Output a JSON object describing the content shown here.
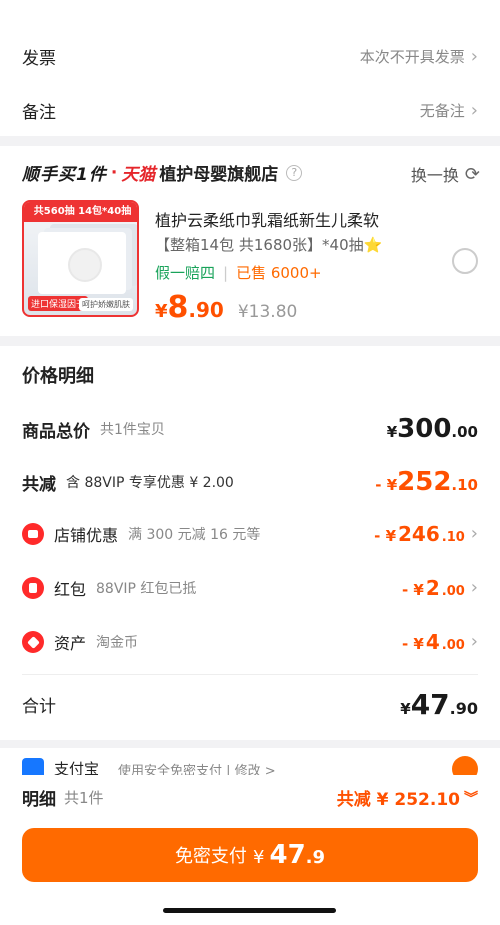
{
  "invoice": {
    "label": "发票",
    "value": "本次不开具发票"
  },
  "remark": {
    "label": "备注",
    "value": "无备注"
  },
  "shop": {
    "brand_sf": "顺手买1件",
    "brand_dot": "·",
    "brand_tm": "天猫",
    "name": "植护母婴旗舰店",
    "help_icon": "question-icon",
    "swap_label": "换一换",
    "swap_icon": "refresh-icon"
  },
  "product": {
    "thumb_top": "共560抽 14包*40抽",
    "thumb_bottom_left": "进口保湿因子",
    "thumb_bottom_right": "呵护娇嫩肌肤",
    "title": "植护云柔纸巾乳霜纸新生儿柔软",
    "spec": "【整箱14包 共1680张】*40抽",
    "spec_star": "⭐",
    "tag_fake": "假一赔四",
    "tag_sep": "|",
    "tag_sold": "已售 6000+",
    "price_currency": "¥",
    "price_int": "8",
    "price_dec": ".90",
    "price_original": "¥13.80"
  },
  "detail": {
    "title": "价格明细",
    "goods_total": {
      "label": "商品总价",
      "sub": "共1件宝贝",
      "currency": "¥",
      "int": "300",
      "dec": ".00"
    },
    "reduce": {
      "label": "共减",
      "sub": "含 88VIP 专享优惠 ¥ 2.00",
      "currency": "- ¥",
      "int": "252",
      "dec": ".10"
    },
    "shop_discount": {
      "label": "店铺优惠",
      "sub": "满 300 元减 16 元等",
      "currency": "- ¥",
      "int": "246",
      "dec": ".10"
    },
    "red_packet": {
      "label": "红包",
      "sub": "88VIP 红包已抵",
      "currency": "- ¥",
      "int": "2",
      "dec": ".00"
    },
    "assets": {
      "label": "资产",
      "sub": "淘金币",
      "currency": "- ¥",
      "int": "4",
      "dec": ".00"
    },
    "total": {
      "label": "合计",
      "currency": "¥",
      "int": "47",
      "dec": ".90"
    }
  },
  "payment_peek": {
    "method": "支付宝",
    "sub": "使用安全免密支付 | 修改 >"
  },
  "bottom": {
    "detail_label": "明细",
    "count": "共1件",
    "reduce": "共减 ¥ 252.10",
    "pay_label": "免密支付",
    "pay_currency": "¥",
    "pay_int": "47",
    "pay_dec": ".9"
  },
  "colors": {
    "accent": "#ff5000",
    "button": "#ff6a00",
    "discount_icon": "#ff2a2a"
  }
}
